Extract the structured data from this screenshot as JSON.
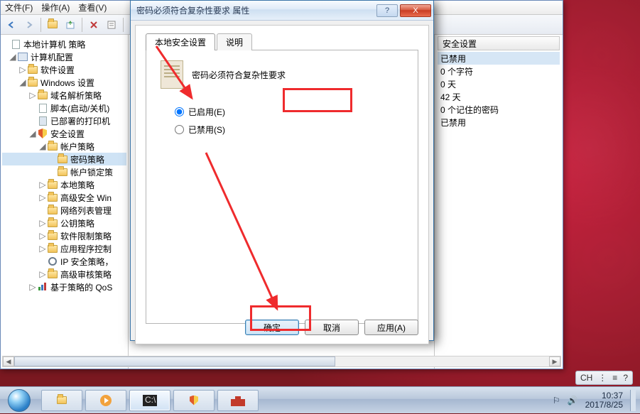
{
  "menu": {
    "file": "文件(F)",
    "action": "操作(A)",
    "view": "查看(V)"
  },
  "tree": {
    "root": "本地计算机 策略",
    "computer": "计算机配置",
    "soft": "软件设置",
    "win": "Windows 设置",
    "dns": "域名解析策略",
    "script": "脚本(启动/关机)",
    "printers": "已部署的打印机",
    "security": "安全设置",
    "account": "帐户策略",
    "password": "密码策略",
    "lockout": "帐户锁定策",
    "local": "本地策略",
    "advfw": "高级安全 Win",
    "netlist": "网络列表管理",
    "pubkey": "公钥策略",
    "swrestrict": "软件限制策略",
    "appctrl": "应用程序控制",
    "ipsec": "IP 安全策略，",
    "audit": "高级审核策略",
    "qos": "基于策略的 QoS"
  },
  "right": {
    "header": "安全设置",
    "r1": "已禁用",
    "r2": "0 个字符",
    "r3": "0 天",
    "r4": "42 天",
    "r5": "0 个记住的密码",
    "r6": "已禁用"
  },
  "dialog": {
    "title": "密码必须符合复杂性要求 属性",
    "tab1": "本地安全设置",
    "tab2": "说明",
    "heading": "密码必须符合复杂性要求",
    "enabled": "已启用(E)",
    "disabled": "已禁用(S)",
    "ok": "确定",
    "cancel": "取消",
    "apply": "应用(A)",
    "help": "?",
    "close": "X"
  },
  "ime": {
    "lang": "CH",
    "tool": "⋮",
    "opts": "≡",
    "help": "?"
  },
  "tray": {
    "time": "10:37",
    "date": "2017/8/25"
  }
}
